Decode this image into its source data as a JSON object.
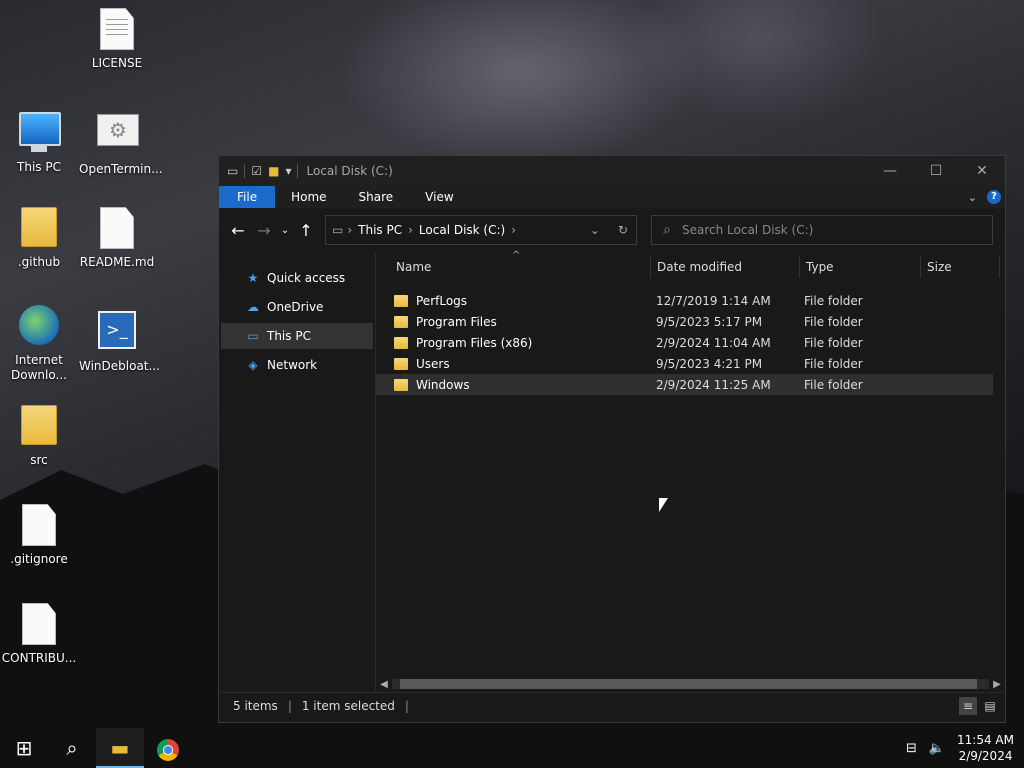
{
  "desktop": {
    "icons": [
      {
        "label": "LICENSE"
      },
      {
        "label": "This PC"
      },
      {
        "label": "OpenTermin..."
      },
      {
        "label": ".github"
      },
      {
        "label": "README.md"
      },
      {
        "label": "Internet Downlo..."
      },
      {
        "label": "WinDebloat..."
      },
      {
        "label": "src"
      },
      {
        "label": ".gitignore"
      },
      {
        "label": "CONTRIBU..."
      }
    ]
  },
  "window": {
    "title": "Local Disk (C:)",
    "controls": {
      "minimize": "—",
      "maximize": "☐",
      "close": "✕"
    },
    "ribbon": {
      "tabs": [
        "File",
        "Home",
        "Share",
        "View"
      ],
      "help": "?"
    },
    "address": {
      "crumbs": [
        "This PC",
        "Local Disk (C:)"
      ]
    },
    "search": {
      "placeholder": "Search Local Disk (C:)"
    },
    "nav": [
      {
        "label": "Quick access",
        "icon": "star-icon"
      },
      {
        "label": "OneDrive",
        "icon": "cloud-icon"
      },
      {
        "label": "This PC",
        "icon": "computer-icon"
      },
      {
        "label": "Network",
        "icon": "network-icon"
      }
    ],
    "columns": [
      "Name",
      "Date modified",
      "Type",
      "Size"
    ],
    "rows": [
      {
        "name": "PerfLogs",
        "date": "12/7/2019 1:14 AM",
        "type": "File folder"
      },
      {
        "name": "Program Files",
        "date": "9/5/2023 5:17 PM",
        "type": "File folder"
      },
      {
        "name": "Program Files (x86)",
        "date": "2/9/2024 11:04 AM",
        "type": "File folder"
      },
      {
        "name": "Users",
        "date": "9/5/2023 4:21 PM",
        "type": "File folder"
      },
      {
        "name": "Windows",
        "date": "2/9/2024 11:25 AM",
        "type": "File folder"
      }
    ],
    "selected_row": "Windows",
    "status": {
      "items": "5 items",
      "selected": "1 item selected"
    }
  },
  "taskbar": {
    "apps": [
      "start",
      "search",
      "file-explorer",
      "chrome"
    ],
    "clock": {
      "time": "11:54 AM",
      "date": "2/9/2024"
    }
  },
  "colors": {
    "accent": "#1b6ac9",
    "window_bg": "#191919",
    "folder": "#e8b93e"
  }
}
